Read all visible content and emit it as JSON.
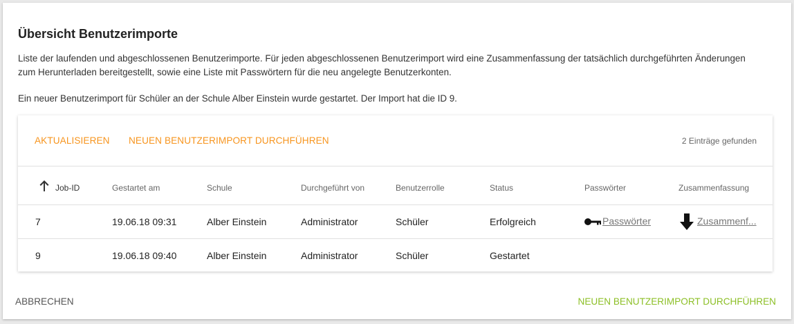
{
  "dialog": {
    "title": "Übersicht Benutzerimporte",
    "description": "Liste der laufenden und abgeschlossenen Benutzerimporte. Für jeden abgeschlossenen Benutzerimport wird eine Zusammenfassung der tatsächlich durchgeführten Änderungen zum Herunterladen bereitgestellt, sowie eine Liste mit Passwörtern für die neu angelegte Benutzerkonten.",
    "notice": "Ein neuer Benutzerimport für Schüler an der Schule Alber Einstein wurde gestartet. Der Import hat die ID 9."
  },
  "toolbar": {
    "refresh_label": "AKTUALISIEREN",
    "new_import_label": "NEUEN BENUTZERIMPORT DURCHFÜHREN",
    "count_text": "2 Einträge gefunden"
  },
  "table": {
    "columns": [
      "Job-ID",
      "Gestartet am",
      "Schule",
      "Durchgeführt von",
      "Benutzerrolle",
      "Status",
      "Passwörter",
      "Zusammenfassung"
    ],
    "sort": {
      "column": "Job-ID",
      "direction": "ascending",
      "icon": "arrow-up-icon"
    },
    "rows": [
      {
        "job_id": "7",
        "started": "19.06.18 09:31",
        "school": "Alber Einstein",
        "by": "Administrator",
        "role": "Schüler",
        "status": "Erfolgreich",
        "passwords_link": "Passwörter",
        "summary_link": "Zusammenf..."
      },
      {
        "job_id": "9",
        "started": "19.06.18 09:40",
        "school": "Alber Einstein",
        "by": "Administrator",
        "role": "Schüler",
        "status": "Gestartet",
        "passwords_link": "",
        "summary_link": ""
      }
    ]
  },
  "footer": {
    "cancel_label": "ABBRECHEN",
    "new_import_label": "NEUEN BENUTZERIMPORT DURCHFÜHREN"
  },
  "colors": {
    "accent_orange": "#f7941d",
    "primary_green": "#8cbf26"
  },
  "icons": [
    "arrow-up-icon",
    "key-icon",
    "download-arrow-icon"
  ]
}
